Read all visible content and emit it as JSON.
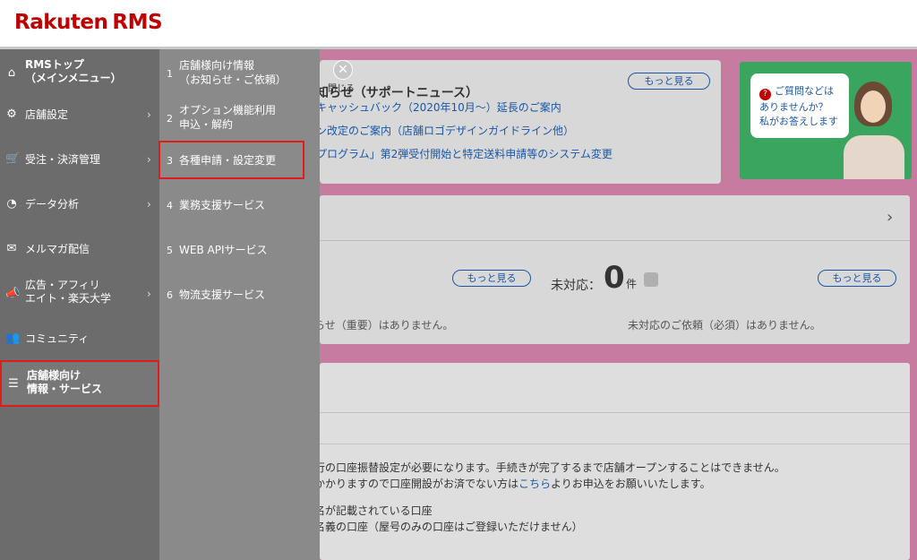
{
  "header": {
    "brand": "Rakuten",
    "product": "RMS"
  },
  "sidebar": {
    "items": [
      {
        "label": "RMSトップ\n（メインメニュー）",
        "icon": "home-icon",
        "has_chevron": false
      },
      {
        "label": "店舗設定",
        "icon": "gear-icon",
        "has_chevron": true
      },
      {
        "label": "受注・決済管理",
        "icon": "cart-icon",
        "has_chevron": true
      },
      {
        "label": "データ分析",
        "icon": "pie-chart-icon",
        "has_chevron": true
      },
      {
        "label": "メルマガ配信",
        "icon": "mail-icon",
        "has_chevron": false
      },
      {
        "label": "広告・アフィリ\nエイト・楽天大学",
        "icon": "megaphone-icon",
        "has_chevron": true
      },
      {
        "label": "コミュニティ",
        "icon": "community-icon",
        "has_chevron": false
      },
      {
        "label": "店舗様向け\n情報・サービス",
        "icon": "list-icon",
        "has_chevron": false,
        "active": true
      }
    ]
  },
  "submenu": {
    "items": [
      {
        "num": "1",
        "label": "店舗様向け情報\n（お知らせ・ご依頼）"
      },
      {
        "num": "2",
        "label": "オプション機能利用\n申込・解約"
      },
      {
        "num": "3",
        "label": "各種申請・設定変更",
        "highlighted": true
      },
      {
        "num": "4",
        "label": "業務支援サービス"
      },
      {
        "num": "5",
        "label": "WEB APIサービス"
      },
      {
        "num": "6",
        "label": "物流支援サービス"
      }
    ]
  },
  "close": {
    "symbol": "✕",
    "label": "閉じる"
  },
  "news": {
    "title": "知らせ（サポートニュース）",
    "more": "もっと見る",
    "links": [
      "キャッシュバック（2020年10月〜）延長のご案内",
      "ン改定のご案内（店舗ロゴデザインガイドライン他）",
      "プログラム」第2弾受付開始と特定送料申請等のシステム変更"
    ]
  },
  "help": {
    "line1": "ご質問などは",
    "line2": "ありませんか？",
    "line3": "私がお答えします"
  },
  "requests": {
    "more_left": "もっと見る",
    "pending_label": "未対応：",
    "pending_count": "0",
    "pending_unit": "件",
    "more_right": "もっと見る",
    "left_empty": "らせ（重要）はありません。",
    "right_empty": "未対応のご依頼（必須）はありません。"
  },
  "account": {
    "line1": "行の口座振替設定が必要になります。手続きが完了するまで店舗オープンすることはできません。",
    "line2_pre": "かかりますので口座開設がお済でない方は",
    "line2_link": "こちら",
    "line2_post": "よりお申込をお願いいたします。",
    "line3": "名が記載されている口座",
    "line4": "名義の口座（屋号のみの口座はご登録いただけません）"
  }
}
